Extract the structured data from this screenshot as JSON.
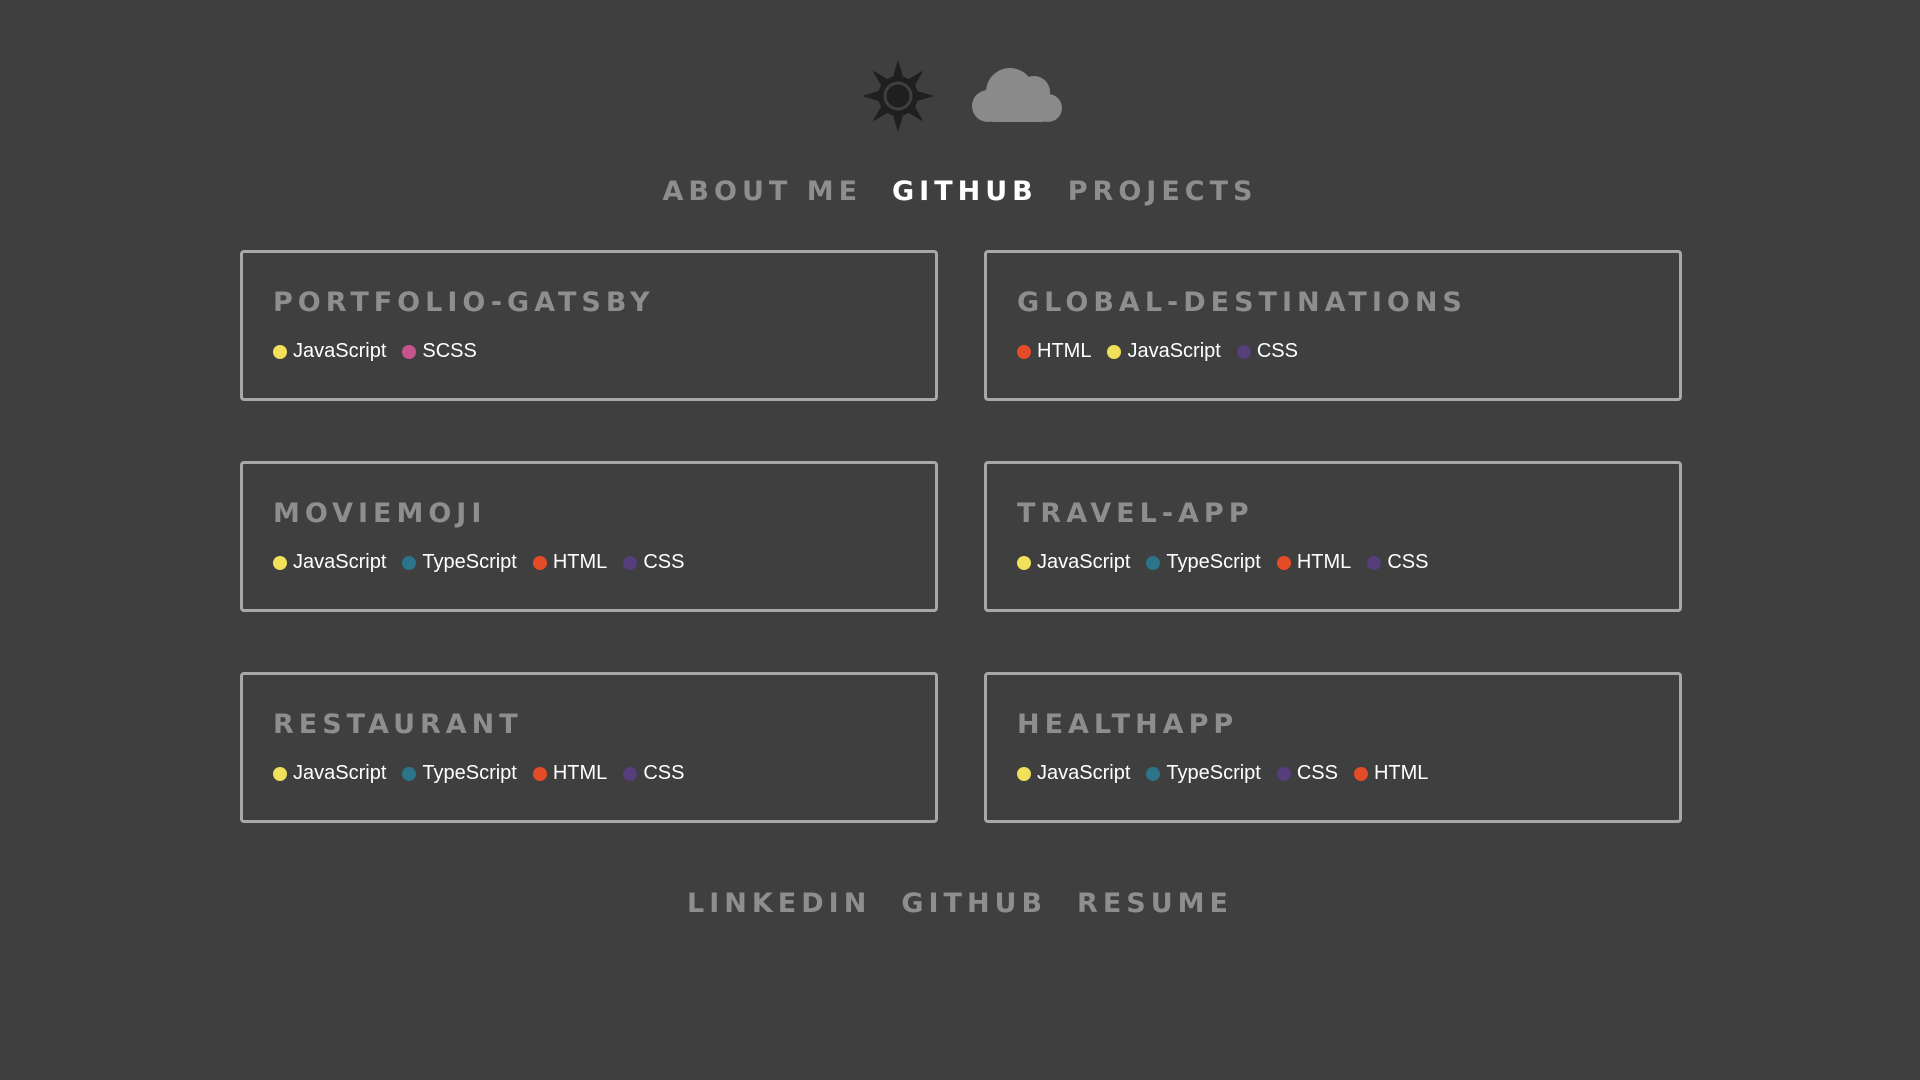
{
  "theme_toggle": {
    "sun_icon": "sun-icon",
    "cloud_icon": "cloud-icon",
    "sun_color": "#1f1f1f",
    "cloud_color": "#8a8a8a"
  },
  "nav": {
    "items": [
      {
        "label": "ABOUT ME",
        "active": false
      },
      {
        "label": "GITHUB",
        "active": true
      },
      {
        "label": "PROJECTS",
        "active": false
      }
    ]
  },
  "repos": [
    {
      "name": "PORTFOLIO-GATSBY",
      "languages": [
        {
          "name": "JavaScript",
          "color": "#f1e05a"
        },
        {
          "name": "SCSS",
          "color": "#c6538c"
        }
      ]
    },
    {
      "name": "GLOBAL-DESTINATIONS",
      "languages": [
        {
          "name": "HTML",
          "color": "#e34c26"
        },
        {
          "name": "JavaScript",
          "color": "#f1e05a"
        },
        {
          "name": "CSS",
          "color": "#563d7c"
        }
      ]
    },
    {
      "name": "MOVIEMOJI",
      "languages": [
        {
          "name": "JavaScript",
          "color": "#f1e05a"
        },
        {
          "name": "TypeScript",
          "color": "#2b7489"
        },
        {
          "name": "HTML",
          "color": "#e34c26"
        },
        {
          "name": "CSS",
          "color": "#563d7c"
        }
      ]
    },
    {
      "name": "TRAVEL-APP",
      "languages": [
        {
          "name": "JavaScript",
          "color": "#f1e05a"
        },
        {
          "name": "TypeScript",
          "color": "#2b7489"
        },
        {
          "name": "HTML",
          "color": "#e34c26"
        },
        {
          "name": "CSS",
          "color": "#563d7c"
        }
      ]
    },
    {
      "name": "RESTAURANT",
      "languages": [
        {
          "name": "JavaScript",
          "color": "#f1e05a"
        },
        {
          "name": "TypeScript",
          "color": "#2b7489"
        },
        {
          "name": "HTML",
          "color": "#e34c26"
        },
        {
          "name": "CSS",
          "color": "#563d7c"
        }
      ]
    },
    {
      "name": "HEALTHAPP",
      "languages": [
        {
          "name": "JavaScript",
          "color": "#f1e05a"
        },
        {
          "name": "TypeScript",
          "color": "#2b7489"
        },
        {
          "name": "CSS",
          "color": "#563d7c"
        },
        {
          "name": "HTML",
          "color": "#e34c26"
        }
      ]
    }
  ],
  "footer": {
    "links": [
      {
        "label": "LINKEDIN"
      },
      {
        "label": "GITHUB"
      },
      {
        "label": "RESUME"
      }
    ]
  }
}
